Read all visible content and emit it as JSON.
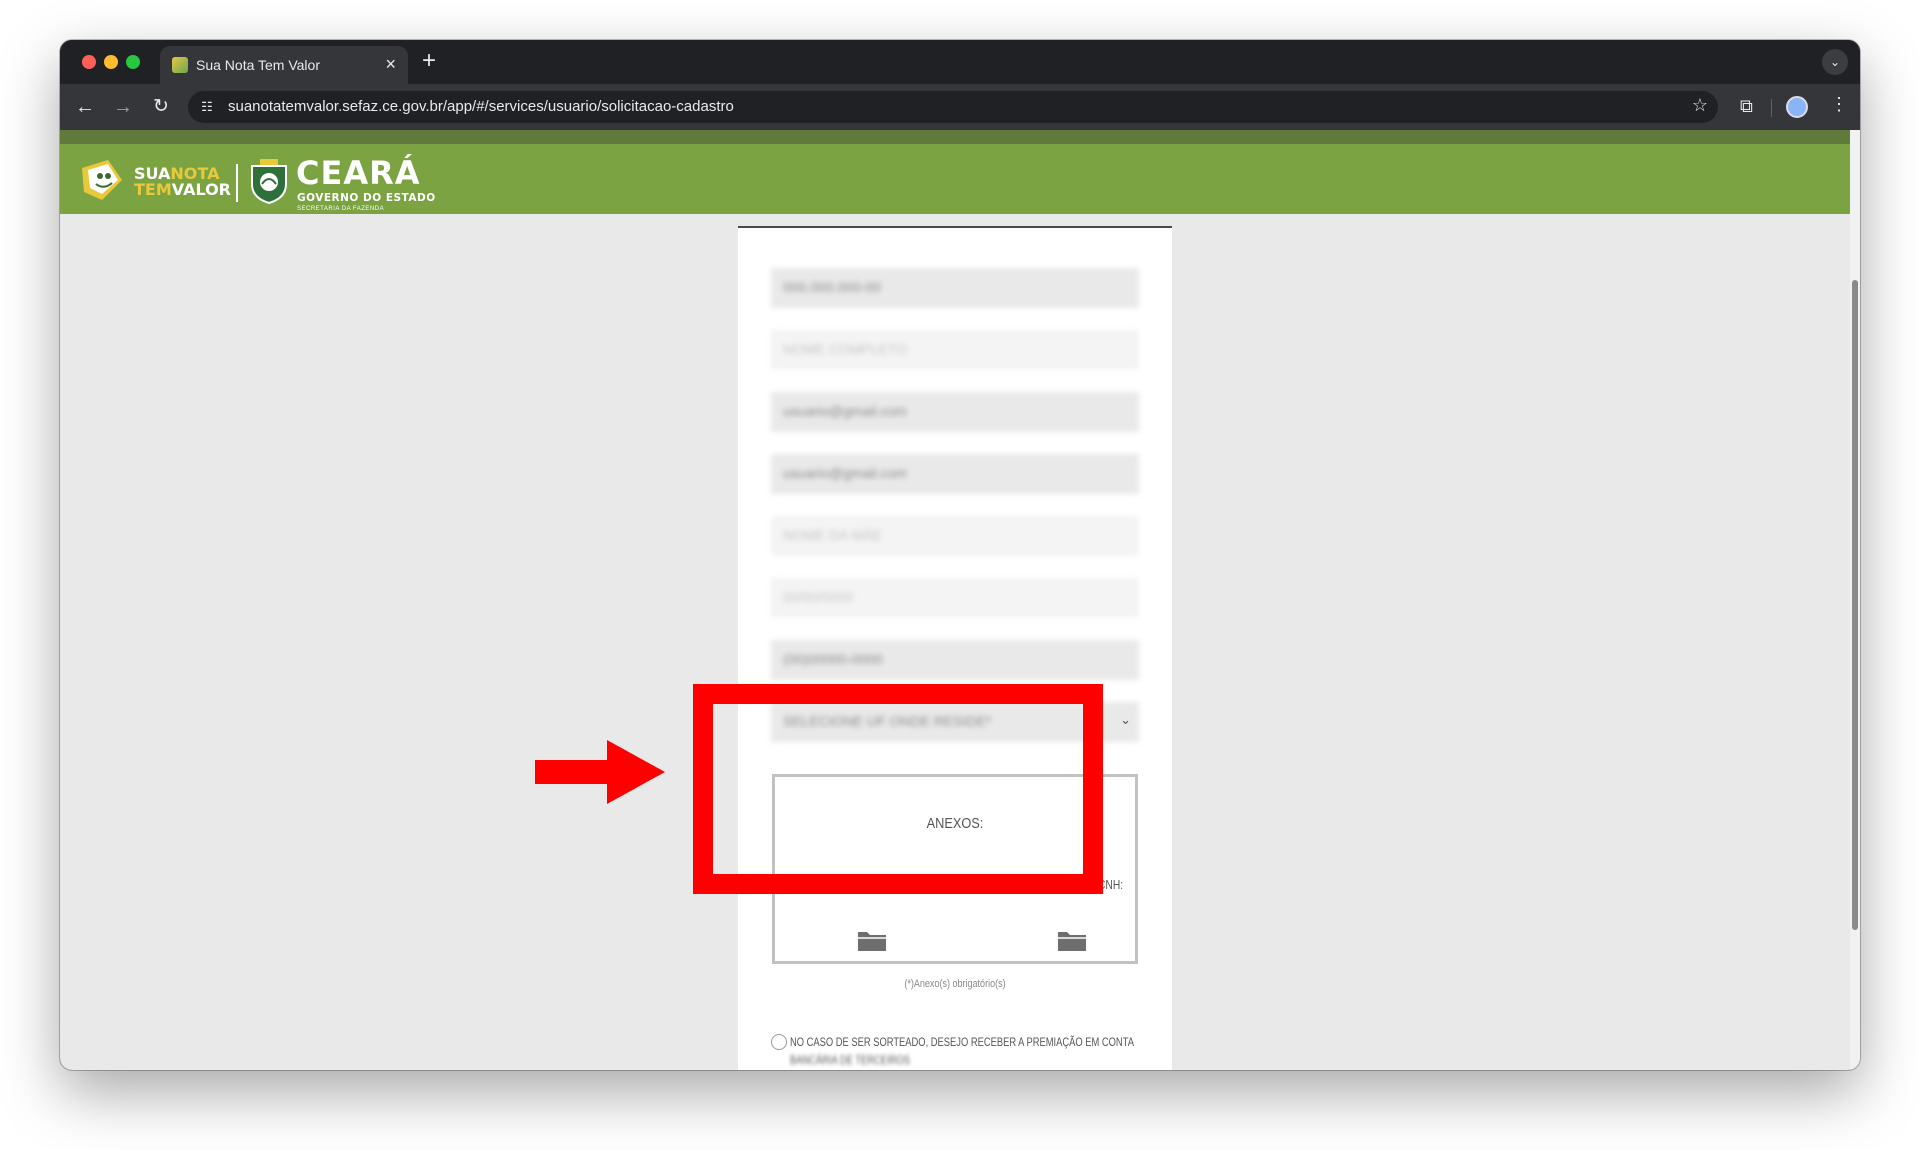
{
  "browser": {
    "tab_title": "Sua Nota Tem Valor",
    "tab_close": "×",
    "new_tab": "+",
    "url": "suanotatemvalor.sefaz.ce.gov.br/app/#/services/usuario/solicitacao-cadastro"
  },
  "logo": {
    "sua": "SUA",
    "nota": "NOTA",
    "tem": "TEM",
    "valor": "VALOR",
    "ceara": "CEARÁ",
    "governo": "GOVERNO DO ESTADO",
    "secretaria": "SECRETARIA DA FAZENDA"
  },
  "form": {
    "fields": [
      {
        "value": "000.000.000-00",
        "style": "filled"
      },
      {
        "value": "NOME COMPLETO",
        "style": "light"
      },
      {
        "value": "usuario@gmail.com",
        "style": "filled"
      },
      {
        "value": "usuario@gmail.com",
        "style": "filled"
      },
      {
        "value": "NOME DA MÃE",
        "style": "light"
      },
      {
        "value": "00/00/0000",
        "style": "light"
      },
      {
        "value": "(00)00000-0000",
        "style": "filled"
      }
    ],
    "uf_select": {
      "value": "SELECIONE UF ONDE RESIDE*"
    },
    "annex": {
      "title": "ANEXOS:",
      "description": "Anexe a foto legível do seu documento de identidade e CPF ou CNH:"
    },
    "required_note": "(*)Anexo(s) obrigatório(s)",
    "prize_option": {
      "label": "NO CASO DE SER SORTEADO, DESEJO RECEBER A PREMIAÇÃO EM CONTA",
      "label_cont": "BANCÁRIA DE TERCEIROS"
    }
  },
  "colors": {
    "header_green": "#7ba342",
    "highlight_red": "#ff0000"
  }
}
